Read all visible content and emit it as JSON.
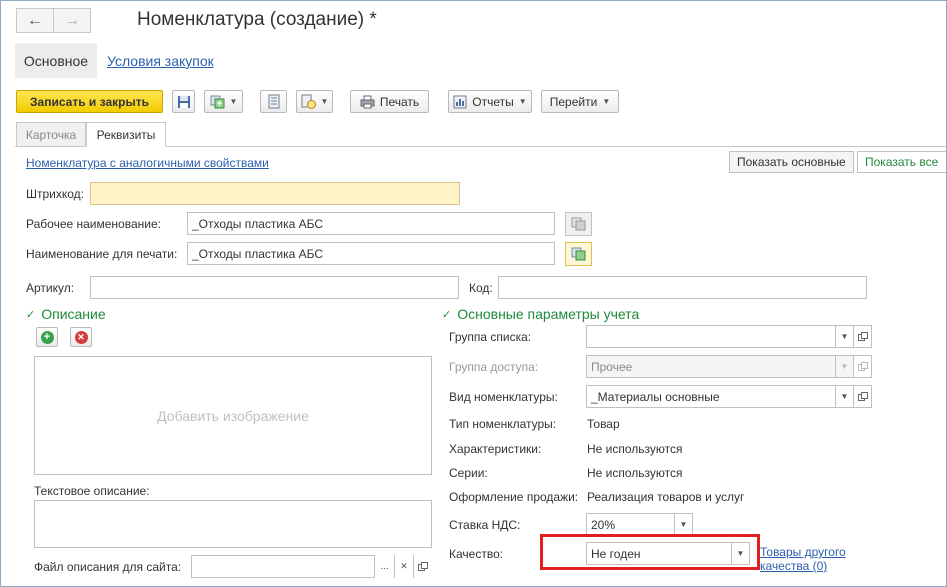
{
  "header": {
    "title": "Номенклатура (создание) *",
    "back_icon": "←",
    "forward_icon": "→"
  },
  "topnav": {
    "active": "Основное",
    "link": "Условия закупок"
  },
  "toolbar": {
    "save_close": "Записать и закрыть",
    "print": "Печать",
    "reports": "Отчеты",
    "goto": "Перейти"
  },
  "tabs": [
    {
      "label": "Карточка",
      "active": false
    },
    {
      "label": "Реквизиты",
      "active": true
    }
  ],
  "form": {
    "similar_link": "Номенклатура с аналогичными свойствами",
    "show_basic": "Показать основные",
    "show_all": "Показать все",
    "barcode_label": "Штрихкод:",
    "barcode_value": "",
    "work_name_label": "Рабочее наименование:",
    "work_name_value": "_Отходы пластика АБС",
    "print_name_label": "Наименование для печати:",
    "print_name_value": "_Отходы пластика АБС",
    "article_label": "Артикул:",
    "article_value": "",
    "code_label": "Код:",
    "code_value": ""
  },
  "description": {
    "heading": "Описание",
    "add_image": "Добавить изображение",
    "text_label": "Текстовое описание:",
    "site_file_label": "Файл описания для сайта:",
    "site_file_value": "",
    "ellipsis": "...",
    "clear": "✕"
  },
  "accounting": {
    "heading": "Основные параметры учета",
    "list_group_label": "Группа списка:",
    "list_group_value": "",
    "access_group_label": "Группа доступа:",
    "access_group_value": "Прочее",
    "kind_label": "Вид номенклатуры:",
    "kind_value": "_Материалы основные",
    "type_label": "Тип номенклатуры:",
    "type_value": "Товар",
    "characteristics_label": "Характеристики:",
    "characteristics_value": "Не используются",
    "series_label": "Серии:",
    "series_value": "Не используются",
    "sale_label": "Оформление продажи:",
    "sale_value": "Реализация товаров и услуг",
    "vat_label": "Ставка НДС:",
    "vat_value": "20%",
    "quality_label": "Качество:",
    "quality_value": "Не годен",
    "other_quality_link_line1": "Товары другого",
    "other_quality_link_line2": "качества (0)"
  },
  "colors": {
    "accent_green": "#1f8a3a",
    "link_blue": "#2b5fad",
    "primary_yellow": "#f2cc00",
    "highlight_red": "#e02020",
    "barcode_bg": "#fff2c6"
  }
}
